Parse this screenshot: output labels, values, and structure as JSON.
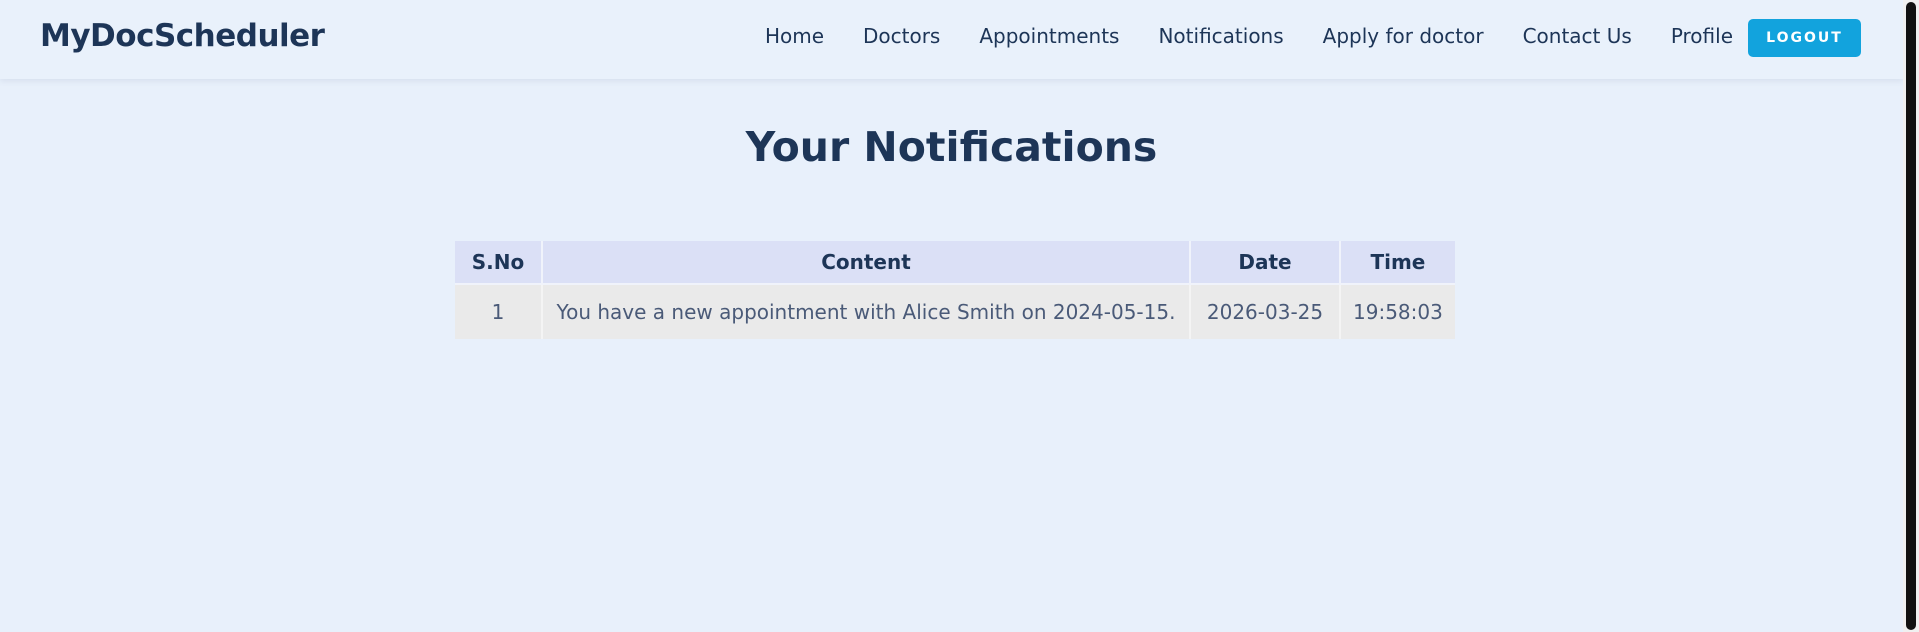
{
  "brand": "MyDocScheduler",
  "nav": {
    "home": "Home",
    "doctors": "Doctors",
    "appointments": "Appointments",
    "notifications": "Notifications",
    "apply": "Apply for doctor",
    "contact": "Contact Us",
    "profile": "Profile",
    "logout": "LOGOUT"
  },
  "page_title": "Your Notifications",
  "table": {
    "headers": [
      "S.No",
      "Content",
      "Date",
      "Time"
    ],
    "rows": [
      [
        "1",
        "You have a new appointment with Alice Smith on 2024-05-15.",
        "2026-03-25",
        "19:58:03"
      ]
    ]
  },
  "colors": {
    "background": "#e8f0fb",
    "primary_text": "#1d3557",
    "logout_button": "#12a3dd",
    "table_header": "#dbe0f6",
    "table_row": "#eaeaea"
  }
}
